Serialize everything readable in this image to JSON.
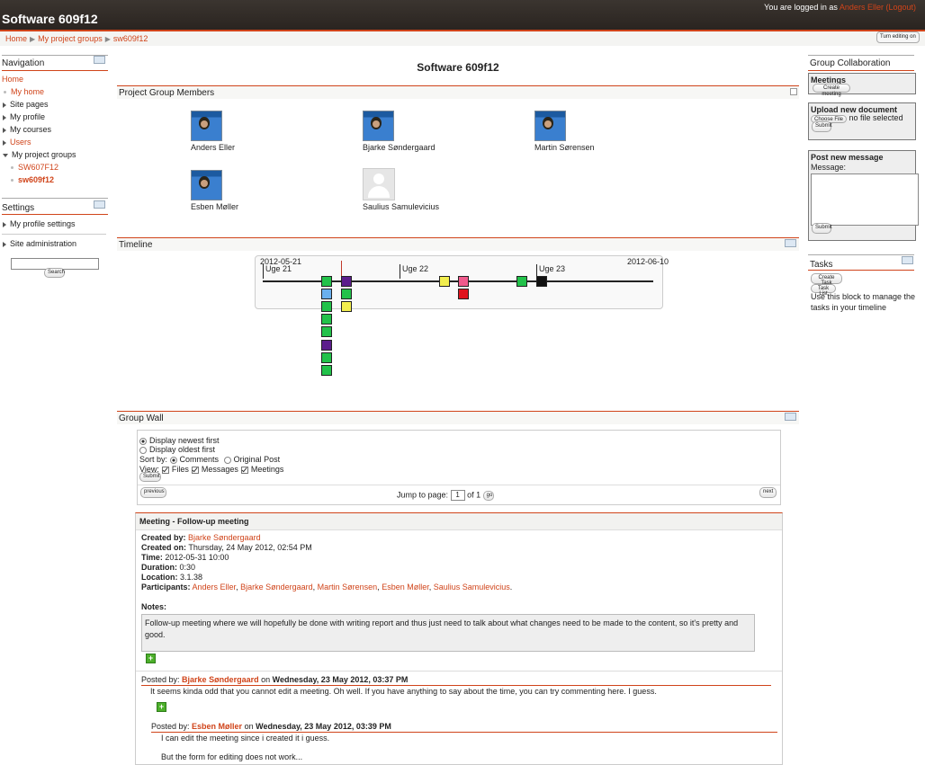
{
  "header": {
    "site_title": "Software 609f12",
    "login_prefix": "You are logged in as",
    "user_name": "Anders Eller",
    "logout_label": "(Logout)",
    "turn_editing_label": "Turn editing on"
  },
  "breadcrumb": [
    "Home",
    "My project groups",
    "sw609f12"
  ],
  "navigation": {
    "title": "Navigation",
    "home": "Home",
    "items": [
      "My home",
      "Site pages",
      "My profile",
      "My courses",
      "Users",
      "My project groups"
    ],
    "subitems": [
      "SW607F12",
      "sw609f12"
    ]
  },
  "settings": {
    "title": "Settings",
    "items": [
      "My profile settings",
      "Site administration"
    ],
    "search_label": "Search"
  },
  "page_title": "Software 609f12",
  "members": {
    "title": "Project Group Members",
    "people": [
      "Anders Eller",
      "Bjarke Søndergaard",
      "Martin Sørensen",
      "Esben Møller",
      "Saulius Samulevicius"
    ]
  },
  "timeline": {
    "title": "Timeline",
    "start_date": "2012-05-21",
    "end_date": "2012-06-10",
    "weeks": [
      "Uge 21",
      "Uge 22",
      "Uge 23"
    ],
    "colors": {
      "green": "#22c24a",
      "purple": "#5c1e8c",
      "blue": "#6ab0ee",
      "yellow": "#f2ee4e",
      "pink": "#f05a8c",
      "red": "#e0141e",
      "black": "#111111"
    }
  },
  "wall": {
    "title": "Group Wall",
    "display_newest": "Display newest first",
    "display_oldest": "Display oldest first",
    "sort_by": "Sort by:",
    "sort_comments": "Comments",
    "sort_original": "Original Post",
    "view": "View:",
    "view_files": "Files",
    "view_messages": "Messages",
    "view_meetings": "Meetings",
    "submit": "Submit",
    "previous": "previous",
    "next": "next",
    "jump_to_page": "Jump to page:",
    "page_value": "1",
    "of_pages": "of 1",
    "go": "go"
  },
  "meeting": {
    "title": "Meeting - Follow-up meeting",
    "created_by_label": "Created by:",
    "created_by": "Bjarke Søndergaard",
    "created_on_label": "Created on:",
    "created_on": "Thursday, 24 May 2012, 02:54 PM",
    "time_label": "Time:",
    "time": "2012-05-31 10:00",
    "duration_label": "Duration:",
    "duration": "0:30",
    "location_label": "Location:",
    "location": "3.1.38",
    "participants_label": "Participants:",
    "participants": [
      "Anders Eller",
      "Bjarke Søndergaard",
      "Martin Sørensen",
      "Esben Møller",
      "Saulius Samulevicius"
    ],
    "notes_label": "Notes:",
    "notes": "Follow-up meeting where we will hopefully be done with writing report and thus just need to talk about what changes need to be made to the content, so it's pretty and good."
  },
  "posts": [
    {
      "posted_by": "Posted by:",
      "author": "Bjarke Søndergaard",
      "on": "on",
      "date": "Wednesday, 23 May 2012, 03:37 PM",
      "text": "It seems kinda odd that you cannot edit a meeting. Oh well. If you have anything to say about the time, you can try commenting here. I guess."
    },
    {
      "posted_by": "Posted by:",
      "author": "Esben Møller",
      "on": "on",
      "date": "Wednesday, 23 May 2012, 03:39 PM",
      "text": "I can edit the meeting since i created it i guess.",
      "text2": "But the form for editing does not work..."
    }
  ],
  "group_collaboration": {
    "title": "Group Collaboration",
    "meetings_title": "Meetings",
    "create_meeting": "Create meeting",
    "upload_title": "Upload new document",
    "choose_file": "Choose File",
    "no_file": "no file selected",
    "submit": "Submit",
    "post_title": "Post new message",
    "message_label": "Message:"
  },
  "tasks": {
    "title": "Tasks",
    "create_task": "Create Task",
    "task_list": "Task List",
    "description": "Use this block to manage the tasks in your timeline"
  }
}
